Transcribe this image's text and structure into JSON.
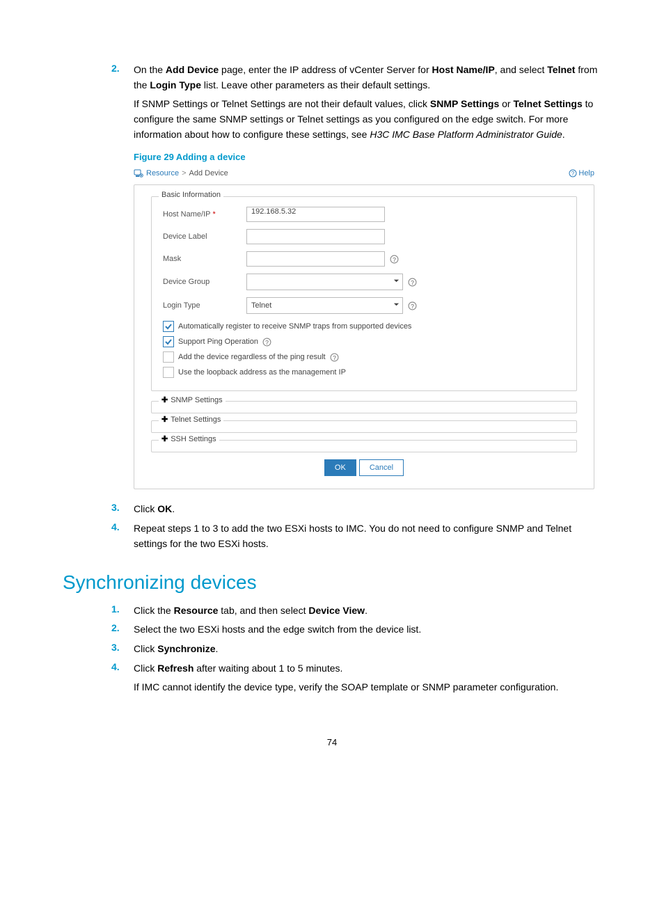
{
  "steps_a": [
    {
      "num": "2.",
      "html": "On the <b>Add Device</b> page, enter the IP address of vCenter Server for <b>Host Name/IP</b>, and select <b>Telnet</b> from the <b>Login Type</b> list. Leave other parameters as their default settings."
    }
  ],
  "paragraph_snmp": "If SNMP Settings or Telnet Settings are not their default values, click <b>SNMP Settings</b> or <b>Telnet Settings</b> to configure the same SNMP settings or Telnet settings as you configured on the edge switch. For more information about how to configure these settings, see <em class='italic'>H3C IMC Base Platform Administrator Guide</em>.",
  "figure_caption": "Figure 29 Adding a device",
  "screenshot": {
    "breadcrumb": {
      "root": "Resource",
      "sep": ">",
      "current": "Add Device"
    },
    "help": "Help",
    "basic_info_legend": "Basic Information",
    "fields": {
      "hostname_label": "Host Name/IP",
      "hostname_required": "*",
      "hostname_value": "192.168.5.32",
      "device_label_label": "Device Label",
      "device_label_value": "",
      "mask_label": "Mask",
      "mask_value": "",
      "device_group_label": "Device Group",
      "device_group_value": "",
      "login_type_label": "Login Type",
      "login_type_value": "Telnet"
    },
    "checkboxes": [
      {
        "checked": true,
        "label": "Automatically register to receive SNMP traps from supported devices",
        "help": false
      },
      {
        "checked": true,
        "label": "Support Ping Operation",
        "help": true
      },
      {
        "checked": false,
        "label": "Add the device regardless of the ping result",
        "help": true
      },
      {
        "checked": false,
        "label": "Use the loopback address as the management IP",
        "help": false
      }
    ],
    "collapsible": [
      "SNMP Settings",
      "Telnet Settings",
      "SSH Settings"
    ],
    "ok": "OK",
    "cancel": "Cancel"
  },
  "steps_b": [
    {
      "num": "3.",
      "html": "Click <b>OK</b>."
    },
    {
      "num": "4.",
      "html": "Repeat steps 1 to 3 to add the two ESXi hosts to IMC. You do not need to configure SNMP and Telnet settings for the two ESXi hosts."
    }
  ],
  "section_heading": "Synchronizing devices",
  "steps_c": [
    {
      "num": "1.",
      "html": "Click the <b>Resource</b> tab, and then select <b>Device View</b>."
    },
    {
      "num": "2.",
      "html": "Select the two ESXi hosts and the edge switch from the device list."
    },
    {
      "num": "3.",
      "html": "Click <b>Synchronize</b>."
    },
    {
      "num": "4.",
      "html": "Click <b>Refresh</b> after waiting about 1 to 5 minutes."
    }
  ],
  "paragraph_soap": "If IMC cannot identify the device type, verify the SOAP template or SNMP parameter configuration.",
  "page_number": "74"
}
